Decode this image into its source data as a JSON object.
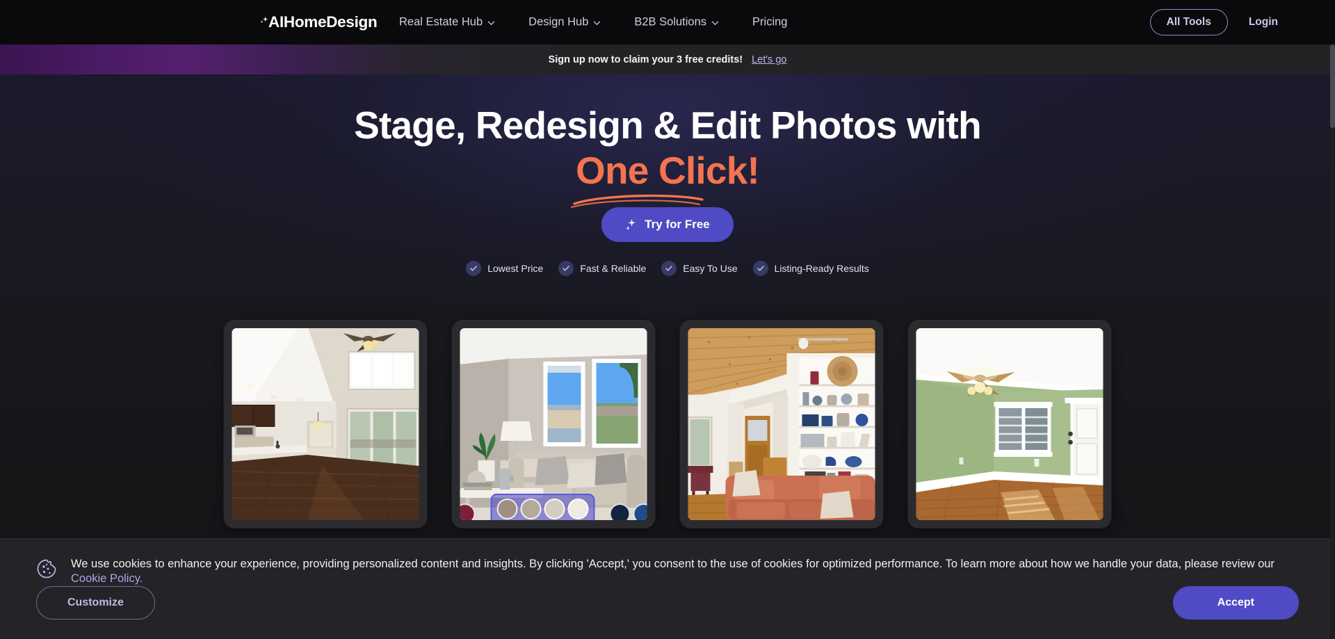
{
  "nav": {
    "brand": "AIHomeDesign",
    "brand_ai": "AI",
    "brand_rest": "HomeDesign",
    "links": [
      {
        "label": "Real Estate Hub",
        "has_chevron": true
      },
      {
        "label": "Design Hub",
        "has_chevron": true
      },
      {
        "label": "B2B Solutions",
        "has_chevron": true
      },
      {
        "label": "Pricing",
        "has_chevron": false
      }
    ],
    "all_tools": "All Tools",
    "login": "Login"
  },
  "promo": {
    "text": "Sign up now to claim your 3 free credits!",
    "link": "Let's go"
  },
  "hero": {
    "headline_line1": "Stage, Redesign & Edit Photos with",
    "headline_line2": "One Click!",
    "cta": "Try for Free",
    "features": [
      {
        "label": "Lowest Price"
      },
      {
        "label": "Fast & Reliable"
      },
      {
        "label": "Easy To Use"
      },
      {
        "label": "Listing-Ready Results"
      }
    ]
  },
  "gallery": {
    "cards": [
      {
        "alt": "empty-vaulted-living-room-with-kitchen-island"
      },
      {
        "alt": "staged-living-room-with-sofa-and-color-palette"
      },
      {
        "alt": "room-with-wood-ceiling-and-built-in-bookshelves"
      },
      {
        "alt": "empty-green-walled-room-with-ceiling-fan"
      }
    ]
  },
  "cookie": {
    "text_before_link": "We use cookies to enhance your experience, providing personalized content and insights. By clicking 'Accept,' you consent to the use of cookies for optimized performance. To learn more about how we handle your data, please review our ",
    "link_text": "Cookie Policy.",
    "customize": "Customize",
    "accept": "Accept"
  },
  "colors": {
    "accent_orange": "#f4744f",
    "brand_purple": "#4f4bc4",
    "link_lavender": "#a8a6e8",
    "banner_bg": "#232326",
    "cookie_bg": "#242428"
  }
}
